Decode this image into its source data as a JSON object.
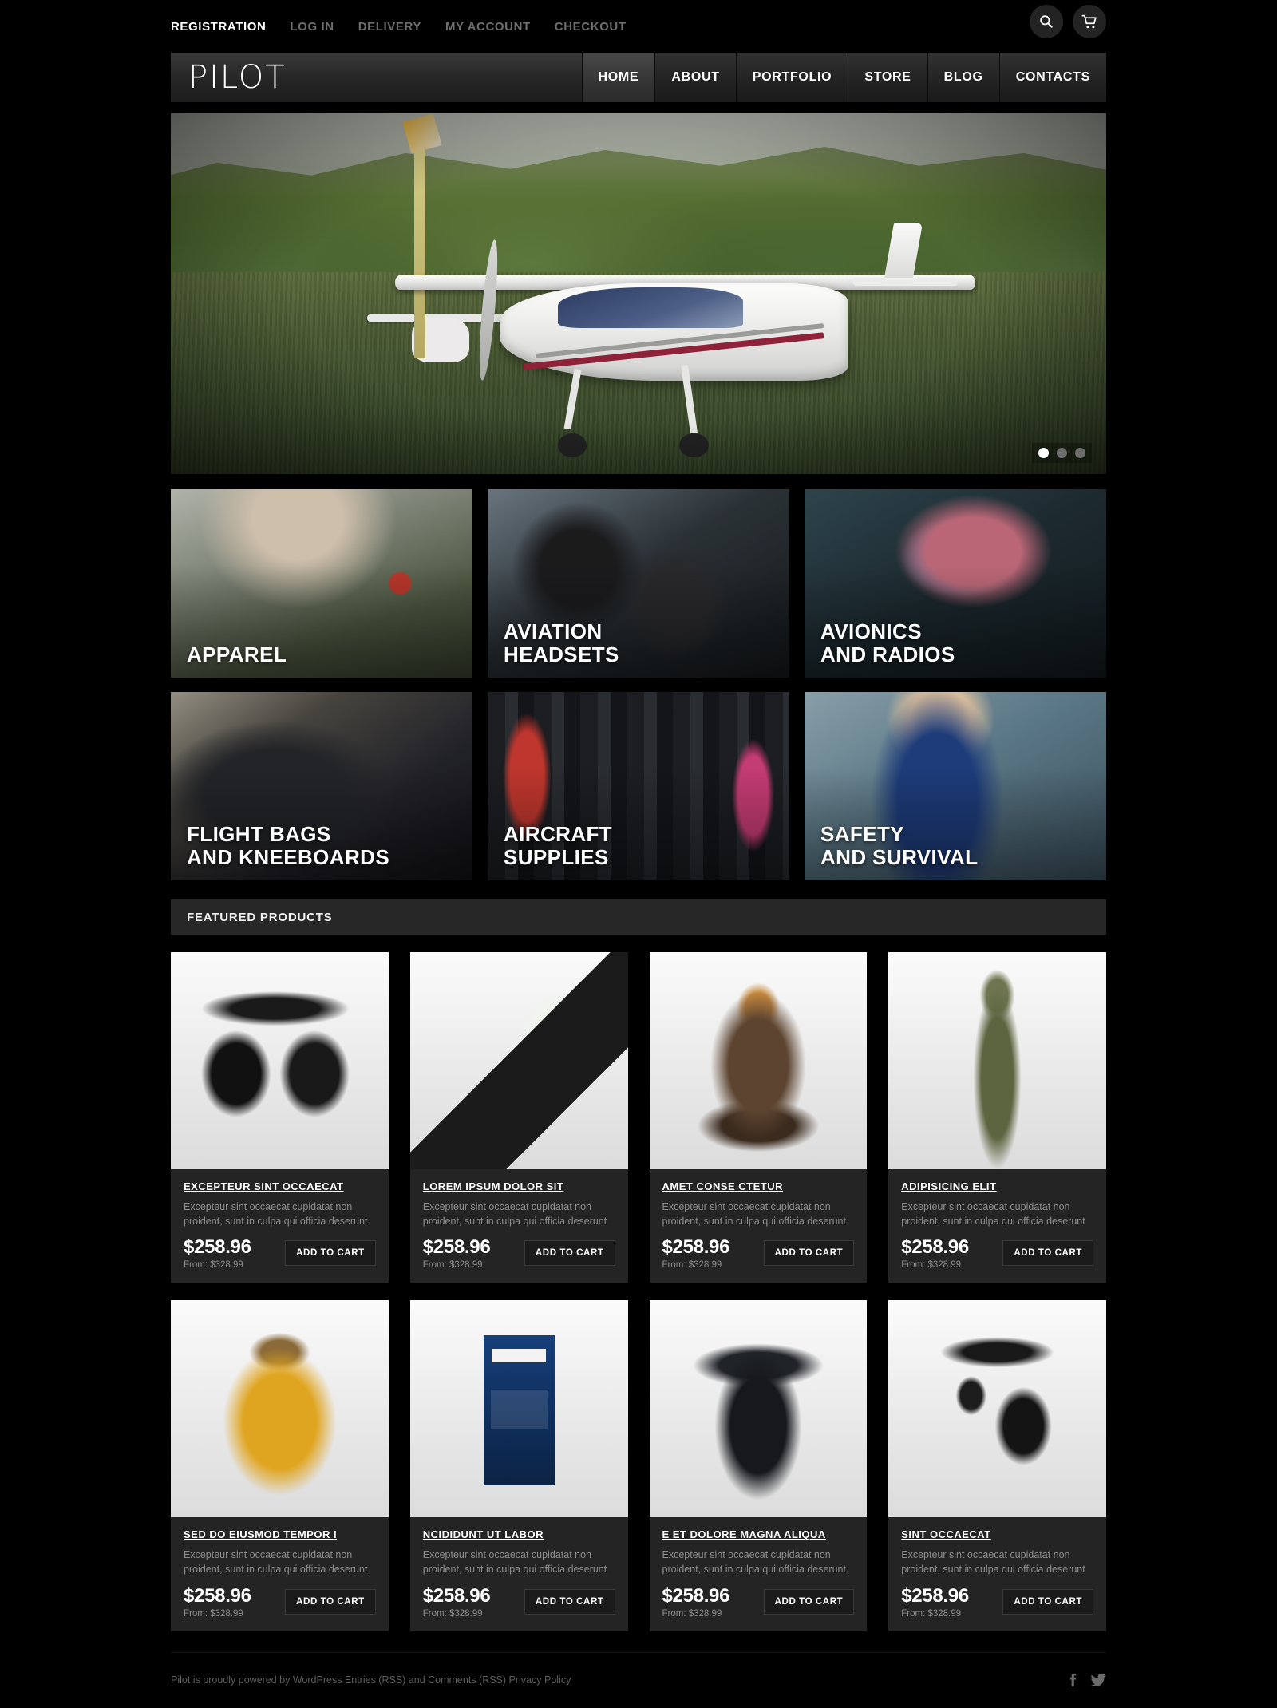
{
  "topbar": {
    "links": [
      {
        "label": "REGISTRATION",
        "active": true
      },
      {
        "label": "LOG IN",
        "active": false
      },
      {
        "label": "DELIVERY",
        "active": false
      },
      {
        "label": "MY ACCOUNT",
        "active": false
      },
      {
        "label": "CHECKOUT",
        "active": false
      }
    ],
    "search_icon": "search-icon",
    "cart_icon": "cart-icon"
  },
  "header": {
    "logo": "PILOT",
    "nav": [
      {
        "label": "HOME",
        "active": true
      },
      {
        "label": "ABOUT",
        "active": false
      },
      {
        "label": "PORTFOLIO",
        "active": false
      },
      {
        "label": "STORE",
        "active": false
      },
      {
        "label": "BLOG",
        "active": false
      },
      {
        "label": "CONTACTS",
        "active": false
      }
    ]
  },
  "slider": {
    "slides": 3,
    "active_slide": 1
  },
  "categories": [
    {
      "label": "APPAREL",
      "art": "art-apparel"
    },
    {
      "label": "AVIATION\nHEADSETS",
      "art": "art-headsets"
    },
    {
      "label": "AVIONICS\nAND RADIOS",
      "art": "art-avionics"
    },
    {
      "label": "FLIGHT BAGS\nAND KNEEBOARDS",
      "art": "art-flightbags"
    },
    {
      "label": "AIRCRAFT\nSUPPLIES",
      "art": "art-supplies"
    },
    {
      "label": "SAFETY\nAND SURVIVAL",
      "art": "art-safety"
    }
  ],
  "featured": {
    "heading": "FEATURED PRODUCTS",
    "cart_button": "ADD TO CART",
    "products": [
      {
        "title": "EXCEPTEUR SINT OCCAECAT",
        "desc": "Excepteur sint occaecat cupidatat non proident, sunt in culpa qui officia deserunt",
        "price": "$258.96",
        "from": "From: $328.99",
        "art": "pa-headset1"
      },
      {
        "title": "LOREM IPSUM DOLOR SIT",
        "desc": "Excepteur sint occaecat cupidatat non proident, sunt in culpa qui officia deserunt",
        "price": "$258.96",
        "from": "From: $328.99",
        "art": "pa-binder"
      },
      {
        "title": "AMET CONSE CTETUR",
        "desc": "Excepteur sint occaecat cupidatat non proident, sunt in culpa qui officia deserunt",
        "price": "$258.96",
        "from": "From: $328.99",
        "art": "pa-jacket"
      },
      {
        "title": "ADIPISICING ELIT",
        "desc": "Excepteur sint occaecat cupidatat non proident, sunt in culpa qui officia deserunt",
        "price": "$258.96",
        "from": "From: $328.99",
        "art": "pa-suit"
      },
      {
        "title": "SED DO EIUSMOD TEMPOR I",
        "desc": "Excepteur sint occaecat cupidatat non proident, sunt in culpa qui officia deserunt",
        "price": "$258.96",
        "from": "From: $328.99",
        "art": "pa-yellow"
      },
      {
        "title": "NCIDIDUNT UT LABOR",
        "desc": "Excepteur sint occaecat cupidatat non proident, sunt in culpa qui officia deserunt",
        "price": "$258.96",
        "from": "From: $328.99",
        "art": "pa-book"
      },
      {
        "title": "E ET DOLORE MAGNA ALIQUA",
        "desc": "Excepteur sint occaecat cupidatat non proident, sunt in culpa qui officia deserunt",
        "price": "$258.96",
        "from": "From: $328.99",
        "art": "pa-sweater"
      },
      {
        "title": "SINT OCCAECAT",
        "desc": "Excepteur sint occaecat cupidatat non proident, sunt in culpa qui officia deserunt",
        "price": "$258.96",
        "from": "From: $328.99",
        "art": "pa-headset2"
      }
    ]
  },
  "footer": {
    "text": "Pilot is proudly powered by WordPress Entries (RSS) and Comments (RSS) Privacy Policy",
    "socials": [
      "facebook-icon",
      "twitter-icon"
    ]
  },
  "colors": {
    "page_bg": "#000000",
    "panel": "#242424",
    "bar": "#272727",
    "text": "#ffffff",
    "muted": "#8d8d8d",
    "dim": "#5f5f5f"
  }
}
